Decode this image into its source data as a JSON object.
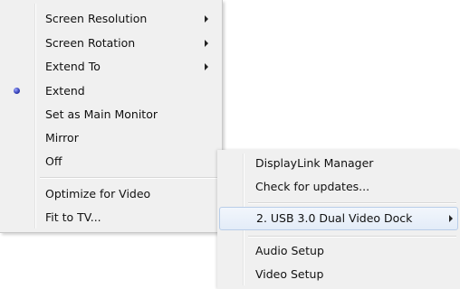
{
  "main_menu": {
    "items": [
      {
        "label": "Screen Resolution",
        "submenu": true
      },
      {
        "label": "Screen Rotation",
        "submenu": true
      },
      {
        "label": "Extend To",
        "submenu": true
      },
      {
        "label": "Extend",
        "selected": true
      },
      {
        "label": "Set as Main Monitor"
      },
      {
        "label": "Mirror"
      },
      {
        "label": "Off"
      },
      {
        "label": "Optimize for Video"
      },
      {
        "label": "Fit to TV..."
      }
    ]
  },
  "sub_menu": {
    "items": [
      {
        "label": "DisplayLink Manager"
      },
      {
        "label": "Check for updates..."
      },
      {
        "label": "2. USB 3.0 Dual Video Dock",
        "submenu": true,
        "highlighted": true
      },
      {
        "label": "Audio Setup"
      },
      {
        "label": "Video Setup"
      }
    ]
  },
  "colors": {
    "menu_background": "#f0f0f0",
    "highlight_border": "#b8cde8",
    "radio_dot": "#3742b8"
  }
}
